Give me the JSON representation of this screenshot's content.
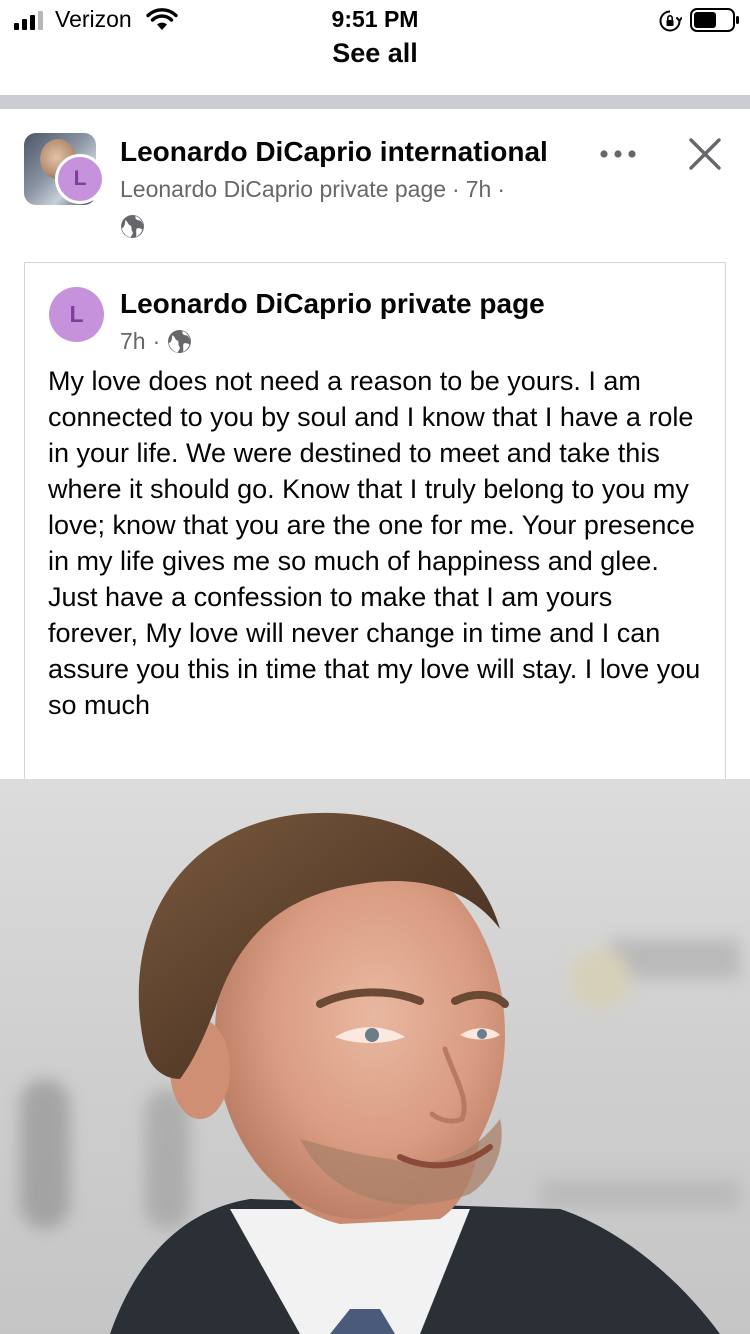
{
  "status_bar": {
    "carrier": "Verizon",
    "time": "9:51 PM"
  },
  "header": {
    "see_all_label": "See all"
  },
  "post": {
    "page_name": "Leonardo DiCaprio international",
    "shared_from": "Leonardo DiCaprio private page",
    "separator": "·",
    "time_ago": "7h",
    "avatar_letter": "L",
    "shared_post": {
      "author": "Leonardo DiCaprio private page",
      "avatar_letter": "L",
      "time_ago": "7h",
      "separator": "·",
      "body": "My love does not need a reason to be yours. I am connected to you by soul and I know that I have a role in your life. We were destined to meet and take this where it should go. Know that I truly belong to you my love; know that you are the one for me. Your presence in my life gives me so much of happiness and glee. Just have a confession to make that I am yours forever, My love will never change in time and I can assure you this in time that my love will stay. I love you so much"
    }
  },
  "icons": {
    "signal": "signal-bars-icon",
    "wifi": "wifi-icon",
    "orientation_lock": "orientation-lock-icon",
    "battery": "battery-icon",
    "more": "more-options-icon",
    "close": "close-icon",
    "globe": "globe-icon"
  }
}
